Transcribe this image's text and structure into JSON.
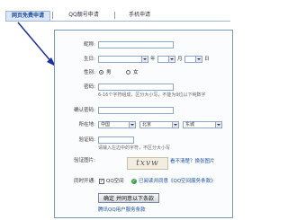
{
  "tabs": [
    "网页免费申请",
    "QQ靓号申请",
    "手机申请"
  ],
  "form": {
    "nickname_label": "昵称:",
    "birthday_label": "生日:",
    "birthday_year_unit": "年",
    "birthday_month_unit": "月",
    "birthday_day_unit": "日",
    "gender_label": "性别:",
    "gender_male": "男",
    "gender_female": "女",
    "password_label": "密码:",
    "password_hint": "6-16个字符组成，区分大小写，不能为9位以下纯数字",
    "confirm_label": "确认密码:",
    "location_label": "所在地:",
    "location_country": "中国",
    "location_province": "北京",
    "location_city": "东城",
    "captcha_label": "验证码:",
    "captcha_hint": "请输入左边中的字符，不区分大小写",
    "captcha_image_label": "验证图片:",
    "captcha_text": "txvw",
    "captcha_refresh": "看不清楚？换张图片",
    "open_label": "同时开通:",
    "open_qzone": "QQ空间",
    "open_agree": "已阅读并同意《QQ空间服务条款》",
    "submit_label": "确定 并同意以下条款",
    "terms_link": "腾讯QQ用户服务条款"
  },
  "colors": {
    "accent": "#1b4fa5",
    "border": "#7a97c2",
    "tab_bg": "#dce7f5"
  }
}
